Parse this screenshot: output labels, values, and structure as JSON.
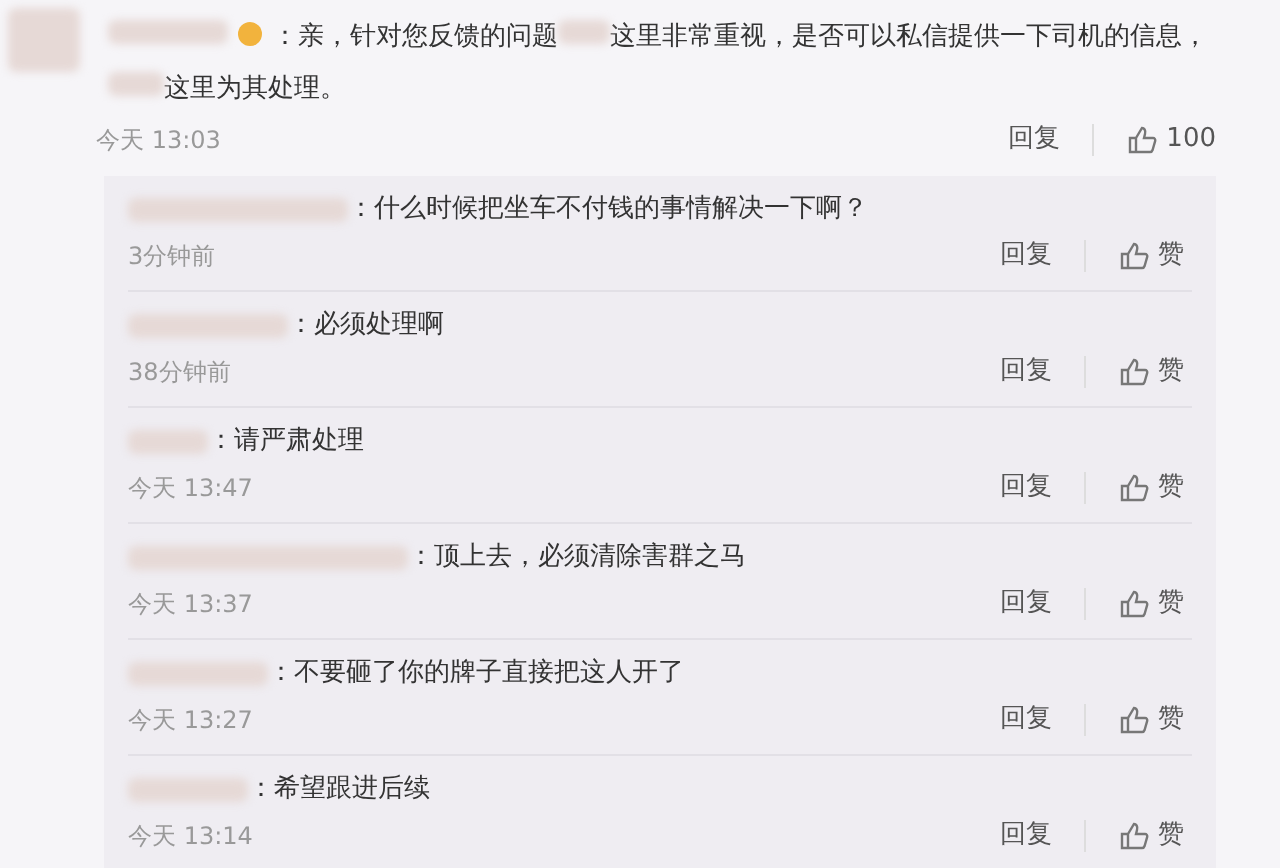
{
  "comment": {
    "text_parts": [
      "：亲，针对您反馈的问题",
      "这里非常重视，是否可以私信提供一下司机的信息，",
      "这里为其处理。"
    ],
    "time": "今天 13:03",
    "reply_label": "回复",
    "likes": "100"
  },
  "replies": [
    {
      "text": "：什么时候把坐车不付钱的事情解决一下啊？",
      "time": "3分钟前",
      "reply_label": "回复",
      "like_label": "赞"
    },
    {
      "text": "：必须处理啊",
      "time": "38分钟前",
      "reply_label": "回复",
      "like_label": "赞"
    },
    {
      "text": "：请严肃处理",
      "time": "今天 13:47",
      "reply_label": "回复",
      "like_label": "赞"
    },
    {
      "text": "：顶上去，必须清除害群之马",
      "time": "今天 13:37",
      "reply_label": "回复",
      "like_label": "赞"
    },
    {
      "text": "：不要砸了你的牌子直接把这人开了",
      "time": "今天 13:27",
      "reply_label": "回复",
      "like_label": "赞"
    },
    {
      "text": "：希望跟进后续",
      "time": "今天 13:14",
      "reply_label": "回复",
      "like_label": "赞"
    }
  ]
}
